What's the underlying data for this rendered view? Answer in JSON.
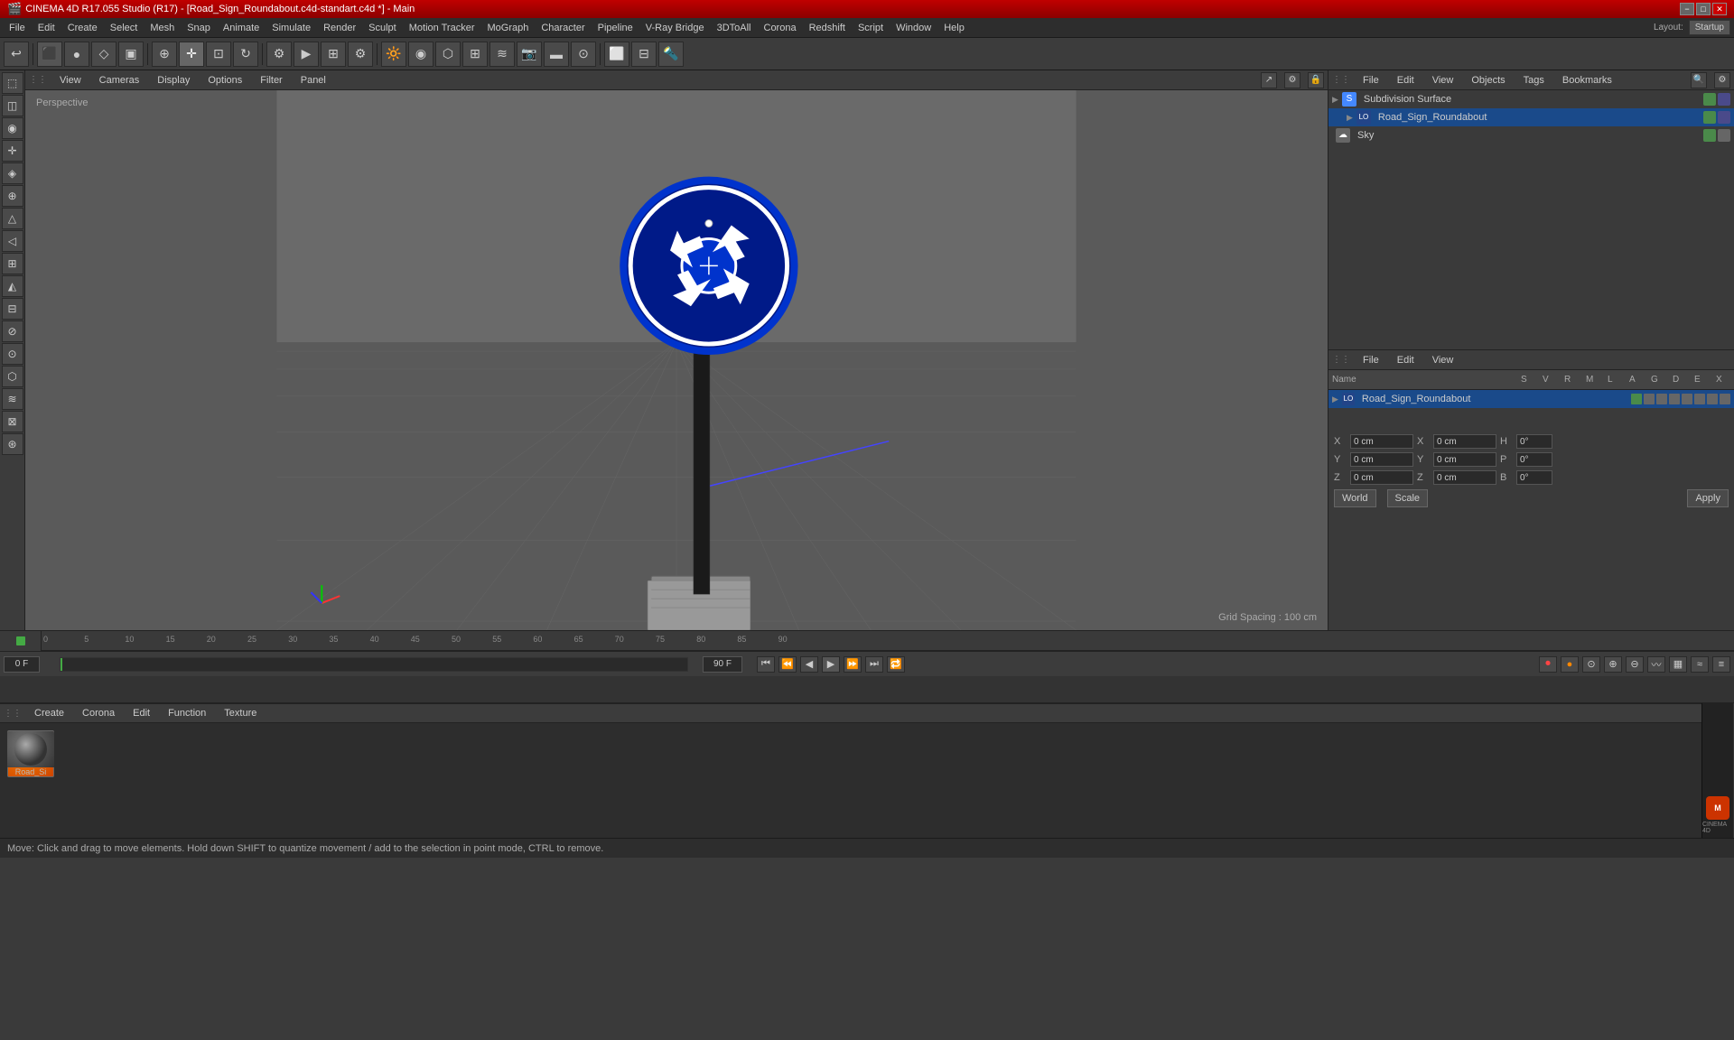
{
  "titlebar": {
    "title": "CINEMA 4D R17.055 Studio (R17) - [Road_Sign_Roundabout.c4d-standart.c4d *] - Main",
    "minimize": "−",
    "maximize": "□",
    "close": "✕"
  },
  "menubar": {
    "items": [
      "File",
      "Edit",
      "Create",
      "Select",
      "Mesh",
      "Snap",
      "Animate",
      "Simulate",
      "Render",
      "Sculpt",
      "Motion Tracker",
      "MoGraph",
      "Character",
      "Pipeline",
      "V-Ray Bridge",
      "3DToAll",
      "Corona",
      "Redshift",
      "Script",
      "Window",
      "Help"
    ]
  },
  "viewport": {
    "label": "Perspective",
    "grid_spacing": "Grid Spacing : 100 cm",
    "toolbar_items": [
      "View",
      "Cameras",
      "Display",
      "Options",
      "Filter",
      "Panel"
    ]
  },
  "object_manager": {
    "title_items": [
      "File",
      "Edit",
      "View",
      "Objects",
      "Tags",
      "Bookmarks"
    ],
    "objects": [
      {
        "name": "Subdivision Surface",
        "indent": 0,
        "type": "subdivision",
        "color": "#4488ff"
      },
      {
        "name": "Road_Sign_Roundabout",
        "indent": 1,
        "type": "group",
        "color": "#4444cc"
      },
      {
        "name": "Sky",
        "indent": 0,
        "type": "sky",
        "color": "#888888"
      }
    ]
  },
  "attribute_manager": {
    "title_items": [
      "File",
      "Edit",
      "View"
    ],
    "selected": "Road_Sign_Roundabout",
    "columns": [
      "Name",
      "S",
      "V",
      "R",
      "M",
      "L",
      "A",
      "G",
      "D",
      "E",
      "X"
    ],
    "coord": {
      "x_pos": "0 cm",
      "y_pos": "0 cm",
      "z_pos": "0 cm",
      "x_rot": "0 cm",
      "y_rot": "0 cm",
      "z_rot": "0 cm",
      "h": "0°",
      "p": "0°",
      "b": "0°"
    }
  },
  "timeline": {
    "start_frame": "0 F",
    "end_frame": "90 F",
    "current_frame": "0 F",
    "frame_labels": [
      "0",
      "5",
      "10",
      "15",
      "20",
      "25",
      "30",
      "35",
      "40",
      "45",
      "50",
      "55",
      "60",
      "65",
      "70",
      "75",
      "80",
      "85",
      "90"
    ]
  },
  "material": {
    "tabs": [
      "Create",
      "Edit",
      "Function",
      "Texture"
    ],
    "thumb_label": "Road_Si"
  },
  "coord_panel": {
    "world_btn": "World",
    "scale_btn": "Scale",
    "apply_btn": "Apply",
    "rows": [
      {
        "label": "X",
        "pos": "0 cm",
        "rot_label": "X",
        "rot": "0 cm",
        "h_label": "H",
        "h_val": "0°"
      },
      {
        "label": "Y",
        "pos": "0 cm",
        "rot_label": "Y",
        "rot": "0 cm",
        "p_label": "P",
        "p_val": "0°"
      },
      {
        "label": "Z",
        "pos": "0 cm",
        "rot_label": "Z",
        "rot": "0 cm",
        "b_label": "B",
        "b_val": "0°"
      }
    ]
  },
  "layout": {
    "label": "Layout:",
    "current": "Startup"
  },
  "statusbar": {
    "text": "Move: Click and drag to move elements. Hold down SHIFT to quantize movement / add to the selection in point mode, CTRL to remove."
  }
}
